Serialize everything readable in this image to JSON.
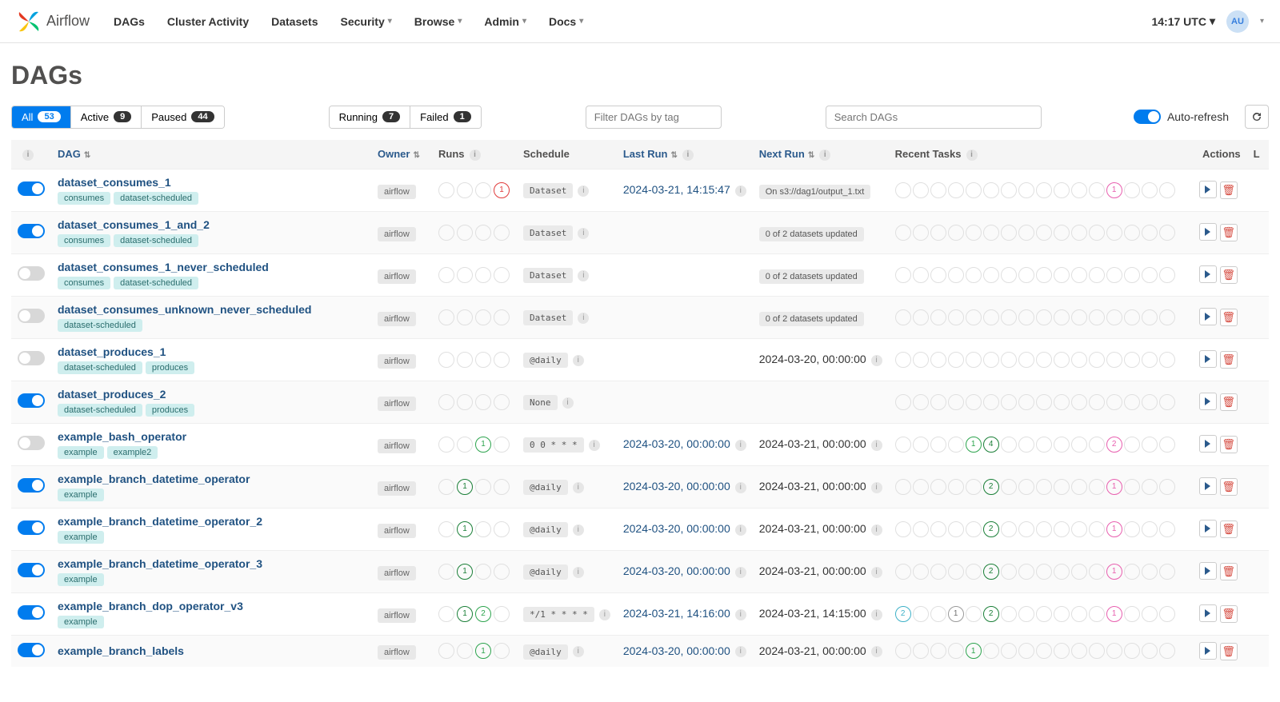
{
  "brand": "Airflow",
  "nav": {
    "items": [
      "DAGs",
      "Cluster Activity",
      "Datasets",
      "Security",
      "Browse",
      "Admin",
      "Docs"
    ],
    "has_dropdown": [
      false,
      false,
      false,
      true,
      true,
      true,
      true
    ]
  },
  "clock": "14:17 UTC",
  "avatar": "AU",
  "page_title": "DAGs",
  "state_filters": [
    {
      "label": "All",
      "count": "53",
      "active": true
    },
    {
      "label": "Active",
      "count": "9"
    },
    {
      "label": "Paused",
      "count": "44"
    }
  ],
  "status_filters": [
    {
      "label": "Running",
      "count": "7"
    },
    {
      "label": "Failed",
      "count": "1"
    }
  ],
  "tag_filter_placeholder": "Filter DAGs by tag",
  "search_placeholder": "Search DAGs",
  "auto_refresh_label": "Auto-refresh",
  "columns": {
    "dag": "DAG",
    "owner": "Owner",
    "runs": "Runs",
    "schedule": "Schedule",
    "last_run": "Last Run",
    "next_run": "Next Run",
    "recent_tasks": "Recent Tasks",
    "actions": "Actions",
    "links": "L"
  },
  "rows": [
    {
      "enabled": true,
      "name": "dataset_consumes_1",
      "tags": [
        "consumes",
        "dataset-scheduled"
      ],
      "owner": "airflow",
      "runs": [
        {},
        {},
        {},
        {
          "cls": "red",
          "n": "1"
        }
      ],
      "schedule": "Dataset",
      "sched_info": true,
      "last_run": "2024-03-21, 14:15:47",
      "last_info": true,
      "next_run_chip": "On s3://dag1/output_1.txt",
      "tasks": [
        {},
        {},
        {},
        {},
        {},
        {},
        {},
        {},
        {},
        {},
        {},
        {},
        {
          "cls": "pink",
          "n": "1"
        },
        {},
        {},
        {}
      ]
    },
    {
      "enabled": true,
      "name": "dataset_consumes_1_and_2",
      "tags": [
        "consumes",
        "dataset-scheduled"
      ],
      "owner": "airflow",
      "runs": [
        {},
        {},
        {},
        {}
      ],
      "schedule": "Dataset",
      "sched_info": true,
      "next_run_chip": "0 of 2 datasets updated",
      "tasks": [
        {},
        {},
        {},
        {},
        {},
        {},
        {},
        {},
        {},
        {},
        {},
        {},
        {},
        {},
        {},
        {}
      ]
    },
    {
      "enabled": false,
      "name": "dataset_consumes_1_never_scheduled",
      "tags": [
        "consumes",
        "dataset-scheduled"
      ],
      "owner": "airflow",
      "runs": [
        {},
        {},
        {},
        {}
      ],
      "schedule": "Dataset",
      "sched_info": true,
      "next_run_chip": "0 of 2 datasets updated",
      "tasks": [
        {},
        {},
        {},
        {},
        {},
        {},
        {},
        {},
        {},
        {},
        {},
        {},
        {},
        {},
        {},
        {}
      ]
    },
    {
      "enabled": false,
      "name": "dataset_consumes_unknown_never_scheduled",
      "tags": [
        "dataset-scheduled"
      ],
      "owner": "airflow",
      "runs": [
        {},
        {},
        {},
        {}
      ],
      "schedule": "Dataset",
      "sched_info": true,
      "next_run_chip": "0 of 2 datasets updated",
      "tasks": [
        {},
        {},
        {},
        {},
        {},
        {},
        {},
        {},
        {},
        {},
        {},
        {},
        {},
        {},
        {},
        {}
      ]
    },
    {
      "enabled": false,
      "name": "dataset_produces_1",
      "tags": [
        "dataset-scheduled",
        "produces"
      ],
      "owner": "airflow",
      "runs": [
        {},
        {},
        {},
        {}
      ],
      "schedule": "@daily",
      "sched_info": true,
      "next_run_text": "2024-03-20, 00:00:00",
      "next_info": true,
      "tasks": [
        {},
        {},
        {},
        {},
        {},
        {},
        {},
        {},
        {},
        {},
        {},
        {},
        {},
        {},
        {},
        {}
      ]
    },
    {
      "enabled": true,
      "name": "dataset_produces_2",
      "tags": [
        "dataset-scheduled",
        "produces"
      ],
      "owner": "airflow",
      "runs": [
        {},
        {},
        {},
        {}
      ],
      "schedule": "None",
      "sched_info": true,
      "tasks": [
        {},
        {},
        {},
        {},
        {},
        {},
        {},
        {},
        {},
        {},
        {},
        {},
        {},
        {},
        {},
        {}
      ]
    },
    {
      "enabled": false,
      "name": "example_bash_operator",
      "tags": [
        "example",
        "example2"
      ],
      "owner": "airflow",
      "runs": [
        {},
        {},
        {
          "cls": "green",
          "n": "1"
        },
        {}
      ],
      "schedule": "0 0 * * *",
      "sched_info": true,
      "last_run": "2024-03-20, 00:00:00",
      "last_info": true,
      "next_run_text": "2024-03-21, 00:00:00",
      "next_info": true,
      "tasks": [
        {},
        {},
        {},
        {},
        {
          "cls": "green",
          "n": "1"
        },
        {
          "cls": "dgreen",
          "n": "4"
        },
        {},
        {},
        {},
        {},
        {},
        {},
        {
          "cls": "pink",
          "n": "2"
        },
        {},
        {},
        {}
      ]
    },
    {
      "enabled": true,
      "name": "example_branch_datetime_operator",
      "tags": [
        "example"
      ],
      "owner": "airflow",
      "runs": [
        {},
        {
          "cls": "dgreen",
          "n": "1"
        },
        {},
        {}
      ],
      "schedule": "@daily",
      "sched_info": true,
      "last_run": "2024-03-20, 00:00:00",
      "last_info": true,
      "next_run_text": "2024-03-21, 00:00:00",
      "next_info": true,
      "tasks": [
        {},
        {},
        {},
        {},
        {},
        {
          "cls": "dgreen",
          "n": "2"
        },
        {},
        {},
        {},
        {},
        {},
        {},
        {
          "cls": "pink",
          "n": "1"
        },
        {},
        {},
        {}
      ]
    },
    {
      "enabled": true,
      "name": "example_branch_datetime_operator_2",
      "tags": [
        "example"
      ],
      "owner": "airflow",
      "runs": [
        {},
        {
          "cls": "dgreen",
          "n": "1"
        },
        {},
        {}
      ],
      "schedule": "@daily",
      "sched_info": true,
      "last_run": "2024-03-20, 00:00:00",
      "last_info": true,
      "next_run_text": "2024-03-21, 00:00:00",
      "next_info": true,
      "tasks": [
        {},
        {},
        {},
        {},
        {},
        {
          "cls": "dgreen",
          "n": "2"
        },
        {},
        {},
        {},
        {},
        {},
        {},
        {
          "cls": "pink",
          "n": "1"
        },
        {},
        {},
        {}
      ]
    },
    {
      "enabled": true,
      "name": "example_branch_datetime_operator_3",
      "tags": [
        "example"
      ],
      "owner": "airflow",
      "runs": [
        {},
        {
          "cls": "dgreen",
          "n": "1"
        },
        {},
        {}
      ],
      "schedule": "@daily",
      "sched_info": true,
      "last_run": "2024-03-20, 00:00:00",
      "last_info": true,
      "next_run_text": "2024-03-21, 00:00:00",
      "next_info": true,
      "tasks": [
        {},
        {},
        {},
        {},
        {},
        {
          "cls": "dgreen",
          "n": "2"
        },
        {},
        {},
        {},
        {},
        {},
        {},
        {
          "cls": "pink",
          "n": "1"
        },
        {},
        {},
        {}
      ]
    },
    {
      "enabled": true,
      "name": "example_branch_dop_operator_v3",
      "tags": [
        "example"
      ],
      "owner": "airflow",
      "runs": [
        {},
        {
          "cls": "dgreen",
          "n": "1"
        },
        {
          "cls": "green",
          "n": "2"
        },
        {}
      ],
      "schedule": "*/1 * * * *",
      "sched_info": true,
      "last_run": "2024-03-21, 14:16:00",
      "last_info": true,
      "next_run_text": "2024-03-21, 14:15:00",
      "next_info": true,
      "tasks": [
        {
          "cls": "teal",
          "n": "2"
        },
        {},
        {},
        {
          "cls": "gray",
          "n": "1"
        },
        {},
        {
          "cls": "dgreen",
          "n": "2"
        },
        {},
        {},
        {},
        {},
        {},
        {},
        {
          "cls": "pink",
          "n": "1"
        },
        {},
        {},
        {}
      ]
    },
    {
      "enabled": true,
      "name": "example_branch_labels",
      "tags": [],
      "owner": "airflow",
      "runs": [
        {},
        {},
        {
          "cls": "green",
          "n": "1"
        },
        {}
      ],
      "schedule": "@daily",
      "sched_info": true,
      "last_run": "2024-03-20, 00:00:00",
      "last_info": true,
      "next_run_text": "2024-03-21, 00:00:00",
      "next_info": true,
      "tasks": [
        {},
        {},
        {},
        {},
        {
          "cls": "green",
          "n": "1"
        },
        {},
        {},
        {},
        {},
        {},
        {},
        {},
        {},
        {},
        {},
        {}
      ]
    }
  ]
}
